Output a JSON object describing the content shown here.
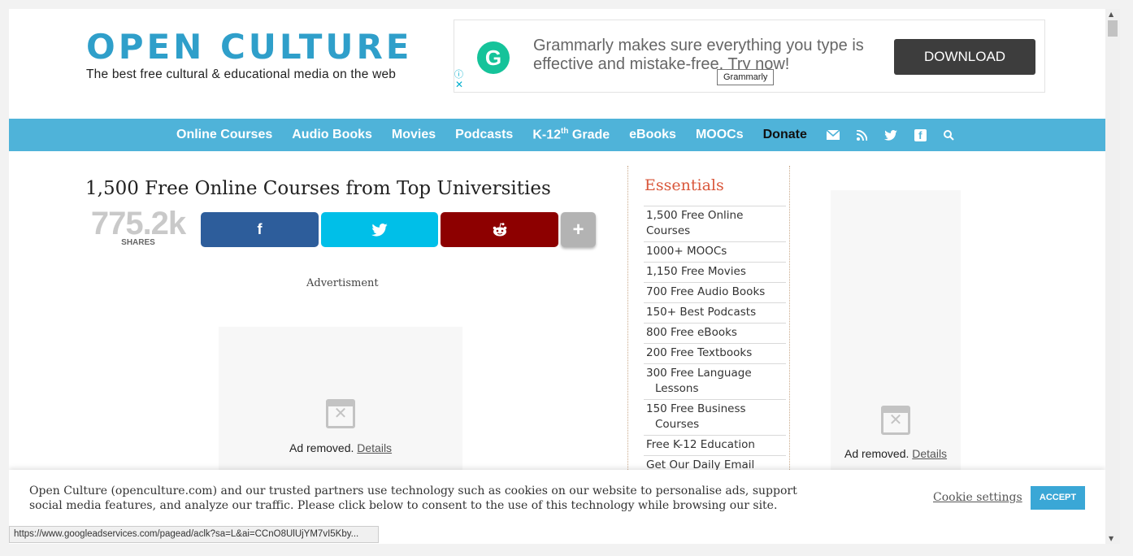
{
  "header": {
    "logo_title": "OPEN CULTURE",
    "logo_tagline": "The best free cultural & educational media on the web"
  },
  "ad_banner": {
    "logo_letter": "G",
    "text": "Grammarly makes sure everything you type is effective and mistake-free. Try now!",
    "button": "DOWNLOAD",
    "tooltip": "Grammarly",
    "info_icon": "ⓘ",
    "close_icon": "✕"
  },
  "nav": {
    "items": [
      "Online Courses",
      "Audio Books",
      "Movies",
      "Podcasts"
    ],
    "k12_prefix": "K-12",
    "k12_sup": "th",
    "k12_suffix": " Grade",
    "items2": [
      "eBooks",
      "MOOCs"
    ],
    "donate": "Donate",
    "icons": [
      "mail-icon",
      "rss-icon",
      "twitter-icon",
      "facebook-icon",
      "search-icon"
    ]
  },
  "article": {
    "title": "1,500 Free Online Courses from Top Universities",
    "share_count": "775.2k",
    "share_label": "SHARES",
    "share_buttons": {
      "facebook": "f",
      "twitter": "🐦",
      "reddit": "👽",
      "more": "+"
    },
    "advertisement_label": "Advertisment"
  },
  "ads": {
    "removed_text": "Ad removed.",
    "details_link": "Details"
  },
  "sidebar": {
    "title": "Essentials",
    "items": [
      "1,500 Free Online Courses",
      "1000+ MOOCs",
      "1,150 Free Movies",
      "700 Free Audio Books",
      "150+ Best Podcasts",
      "800 Free eBooks",
      "200 Free Textbooks"
    ],
    "item_language_1": "300 Free Language",
    "item_language_2": "Lessons",
    "item_business_1": "150 Free Business",
    "item_business_2": "Courses",
    "item_k12": "Free K-12 Education",
    "item_email": "Get Our Daily Email"
  },
  "cookie": {
    "text": "Open Culture (openculture.com) and our trusted partners use technology such as cookies on our website to personalise ads, support social media features, and analyze our traffic. Please click below to consent to the use of this technology while browsing our site.",
    "settings": "Cookie settings",
    "accept": "ACCEPT"
  },
  "status_bar": {
    "url": "https://www.googleadservices.com/pagead/aclk?sa=L&ai=CCnO8UlUjYM7vI5Kby..."
  },
  "colors": {
    "brand_blue": "#2f9fca",
    "nav_blue": "#4fb3d9",
    "sidebar_title": "#d9573b",
    "facebook": "#2d5d9b",
    "twitter": "#00bfe8",
    "reddit": "#8d0000"
  }
}
